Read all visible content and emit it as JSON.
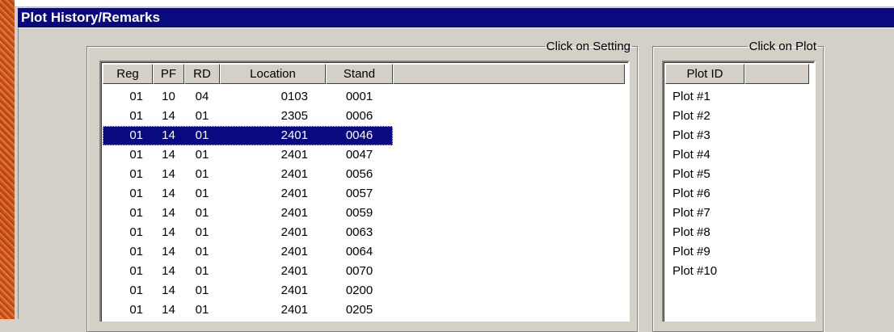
{
  "window": {
    "title": "Plot History/Remarks"
  },
  "settings_group": {
    "legend": "Click on Setting",
    "columns": [
      "Reg",
      "PF",
      "RD",
      "Location",
      "Stand"
    ],
    "selected_index": 2,
    "rows": [
      [
        "01",
        "10",
        "04",
        "0103",
        "0001"
      ],
      [
        "01",
        "14",
        "01",
        "2305",
        "0006"
      ],
      [
        "01",
        "14",
        "01",
        "2401",
        "0046"
      ],
      [
        "01",
        "14",
        "01",
        "2401",
        "0047"
      ],
      [
        "01",
        "14",
        "01",
        "2401",
        "0056"
      ],
      [
        "01",
        "14",
        "01",
        "2401",
        "0057"
      ],
      [
        "01",
        "14",
        "01",
        "2401",
        "0059"
      ],
      [
        "01",
        "14",
        "01",
        "2401",
        "0063"
      ],
      [
        "01",
        "14",
        "01",
        "2401",
        "0064"
      ],
      [
        "01",
        "14",
        "01",
        "2401",
        "0070"
      ],
      [
        "01",
        "14",
        "01",
        "2401",
        "0200"
      ],
      [
        "01",
        "14",
        "01",
        "2401",
        "0205"
      ]
    ]
  },
  "plot_group": {
    "legend": "Click on Plot",
    "column": "Plot ID",
    "items": [
      "Plot #1",
      "Plot #2",
      "Plot #3",
      "Plot #4",
      "Plot #5",
      "Plot #6",
      "Plot #7",
      "Plot #8",
      "Plot #9",
      "Plot #10"
    ]
  },
  "colors": {
    "titlebar": "#0a0a80",
    "selection": "#0a0a80",
    "face": "#d4d0c8"
  }
}
